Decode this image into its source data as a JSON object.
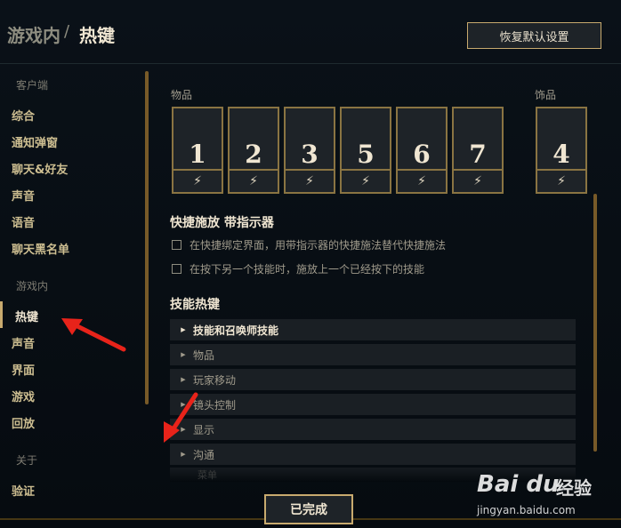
{
  "header": {
    "breadcrumb_parent": "游戏内",
    "breadcrumb_separator": "/",
    "breadcrumb_current": "热键",
    "reset_button": "恢复默认设置"
  },
  "sidebar": {
    "section_client": "客户端",
    "client_items": [
      {
        "label": "综合"
      },
      {
        "label": "通知弹窗"
      },
      {
        "label": "聊天&好友"
      },
      {
        "label": "声音"
      },
      {
        "label": "语音"
      },
      {
        "label": "聊天黑名单"
      }
    ],
    "section_ingame": "游戏内",
    "ingame_items": [
      {
        "label": "热键",
        "active": true
      },
      {
        "label": "声音"
      },
      {
        "label": "界面"
      },
      {
        "label": "游戏"
      },
      {
        "label": "回放"
      }
    ],
    "section_about": "关于",
    "about_items": [
      {
        "label": "验证"
      }
    ]
  },
  "items": {
    "label": "物品",
    "slots": [
      {
        "key": "1",
        "icon": "lightning-icon",
        "glyph": "⚡"
      },
      {
        "key": "2",
        "icon": "lightning-icon",
        "glyph": "⚡"
      },
      {
        "key": "3",
        "icon": "lightning-icon",
        "glyph": "⚡"
      },
      {
        "key": "5",
        "icon": "lightning-icon",
        "glyph": "⚡"
      },
      {
        "key": "6",
        "icon": "lightning-icon",
        "glyph": "⚡"
      },
      {
        "key": "7",
        "icon": "lightning-icon",
        "glyph": "⚡"
      }
    ],
    "trinket_label": "饰品",
    "trinket": {
      "key": "4",
      "icon": "lightning-icon",
      "glyph": "⚡"
    }
  },
  "quick_cast": {
    "title": "快捷施放 带指示器",
    "options": [
      {
        "label": "在快捷绑定界面，用带指示器的快捷施法替代快捷施法",
        "checked": false
      },
      {
        "label": "在按下另一个技能时，施放上一个已经按下的技能",
        "checked": false
      }
    ]
  },
  "ability_hotkeys": {
    "title": "技能热键",
    "categories": [
      {
        "label": "技能和召唤师技能",
        "emphasis": true
      },
      {
        "label": "物品"
      },
      {
        "label": "玩家移动"
      },
      {
        "label": "镜头控制"
      },
      {
        "label": "显示"
      },
      {
        "label": "沟通"
      },
      {
        "label": "菜单"
      }
    ]
  },
  "footer": {
    "done_button": "已完成"
  },
  "watermark": {
    "logo": "Bai du",
    "text": "经验",
    "url": "jingyan.baidu.com"
  },
  "colors": {
    "gold": "#c8aa6e",
    "gold_dark": "#785a28",
    "text_light": "#f0e6d2",
    "text_muted": "#a09b8c",
    "annotation_red": "#e8231a"
  }
}
